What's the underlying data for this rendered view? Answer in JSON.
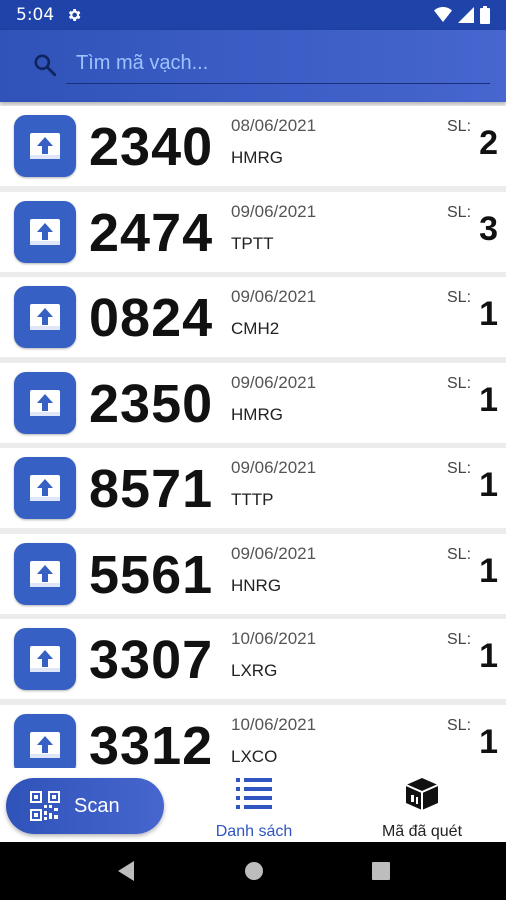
{
  "status_bar": {
    "time": "5:04",
    "icons": [
      "gear-icon",
      "wifi-icon",
      "signal-icon",
      "battery-icon"
    ]
  },
  "search": {
    "placeholder": "Tìm mã vạch...",
    "value": ""
  },
  "items": [
    {
      "code": "2340",
      "date": "08/06/2021",
      "tag": "HMRG",
      "sl_label": "SL:",
      "qty": "2"
    },
    {
      "code": "2474",
      "date": "09/06/2021",
      "tag": "TPTT",
      "sl_label": "SL:",
      "qty": "3"
    },
    {
      "code": "0824",
      "date": "09/06/2021",
      "tag": "CMH2",
      "sl_label": "SL:",
      "qty": "1"
    },
    {
      "code": "2350",
      "date": "09/06/2021",
      "tag": "HMRG",
      "sl_label": "SL:",
      "qty": "1"
    },
    {
      "code": "8571",
      "date": "09/06/2021",
      "tag": "TTTP",
      "sl_label": "SL:",
      "qty": "1"
    },
    {
      "code": "5561",
      "date": "09/06/2021",
      "tag": "HNRG",
      "sl_label": "SL:",
      "qty": "1"
    },
    {
      "code": "3307",
      "date": "10/06/2021",
      "tag": "LXRG",
      "sl_label": "SL:",
      "qty": "1"
    },
    {
      "code": "3312",
      "date": "10/06/2021",
      "tag": "LXCO",
      "sl_label": "SL:",
      "qty": "1"
    }
  ],
  "bottom_nav": {
    "scan_label": "Scan",
    "list_label": "Danh sách",
    "scanned_label": "Mã đã quét",
    "active": "list"
  },
  "colors": {
    "primary": "#2f53b9",
    "active_nav": "#2f55c0",
    "placeholder": "#9ec2ff"
  }
}
